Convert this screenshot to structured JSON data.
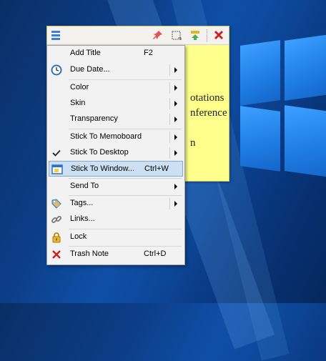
{
  "note": {
    "text_lines": [
      "otations",
      "nference",
      "",
      "n"
    ]
  },
  "menu": {
    "items": [
      {
        "label": "Add Title",
        "shortcut": "F2",
        "icon": "",
        "submenu": false
      },
      {
        "label": "Due Date...",
        "shortcut": "",
        "icon": "clock-icon",
        "submenu": true
      },
      {
        "label": "Color",
        "shortcut": "",
        "icon": "",
        "submenu": true
      },
      {
        "label": "Skin",
        "shortcut": "",
        "icon": "",
        "submenu": true
      },
      {
        "label": "Transparency",
        "shortcut": "",
        "icon": "",
        "submenu": true
      },
      {
        "label": "Stick To Memoboard",
        "shortcut": "",
        "icon": "",
        "submenu": true
      },
      {
        "label": "Stick To Desktop",
        "shortcut": "",
        "icon": "checkmark-icon",
        "submenu": true
      },
      {
        "label": "Stick To Window...",
        "shortcut": "Ctrl+W",
        "icon": "window-icon",
        "submenu": false,
        "highlighted": true
      },
      {
        "label": "Send To",
        "shortcut": "",
        "icon": "",
        "submenu": true
      },
      {
        "label": "Tags...",
        "shortcut": "",
        "icon": "tag-icon",
        "submenu": true
      },
      {
        "label": "Links...",
        "shortcut": "",
        "icon": "link-icon",
        "submenu": false
      },
      {
        "label": "Lock",
        "shortcut": "",
        "icon": "lock-icon",
        "submenu": false
      },
      {
        "label": "Trash Note",
        "shortcut": "Ctrl+D",
        "icon": "trash-x-icon",
        "submenu": false
      }
    ]
  },
  "colors": {
    "note_background": "#ffff8c",
    "highlight": "#cde0f3",
    "trash_red": "#cc2222",
    "desktop_blue": "#0f4fa8"
  }
}
